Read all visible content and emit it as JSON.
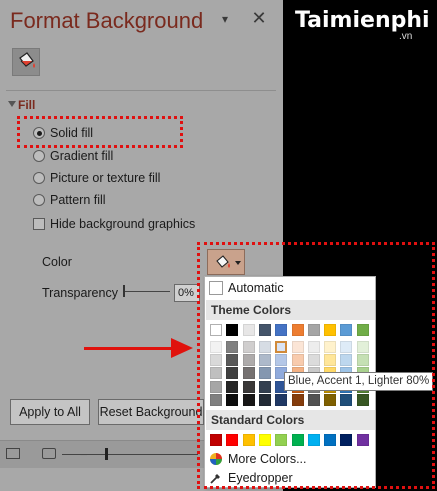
{
  "pane": {
    "title": "Format Background",
    "section": "Fill",
    "options": [
      {
        "label": "Solid fill",
        "selected": true
      },
      {
        "label": "Gradient fill",
        "selected": false
      },
      {
        "label": "Picture or texture fill",
        "selected": false
      },
      {
        "label": "Pattern fill",
        "selected": false
      }
    ],
    "hide_label": "Hide background graphics",
    "color_label": "Color",
    "transparency_label": "Transparency",
    "transparency_value": "0%",
    "apply_label": "Apply to All",
    "reset_label": "Reset Background"
  },
  "popup": {
    "automatic": "Automatic",
    "theme_header": "Theme Colors",
    "standard_header": "Standard Colors",
    "more_colors": "More Colors...",
    "eyedropper": "Eyedropper",
    "theme_top": [
      "#ffffff",
      "#000000",
      "#e7e6e6",
      "#44546a",
      "#4472c4",
      "#ed7d31",
      "#a5a5a5",
      "#ffc000",
      "#5b9bd5",
      "#70ad47"
    ],
    "theme_shades": [
      [
        "#f2f2f2",
        "#808080",
        "#d0cece",
        "#d6dce4",
        "#dae3f3",
        "#fbe5d6",
        "#ededed",
        "#fff2cc",
        "#deebf7",
        "#e2f0d9"
      ],
      [
        "#d9d9d9",
        "#595959",
        "#aeabab",
        "#adb9ca",
        "#b4c7e7",
        "#f8cbad",
        "#dbdbdb",
        "#ffe699",
        "#bdd7ee",
        "#c5e0b4"
      ],
      [
        "#bfbfbf",
        "#404040",
        "#757171",
        "#8497b0",
        "#8faadc",
        "#f4b183",
        "#c9c9c9",
        "#ffd966",
        "#9dc3e6",
        "#a9d18e"
      ],
      [
        "#a6a6a6",
        "#262626",
        "#3a3838",
        "#333f50",
        "#2f5597",
        "#c55a11",
        "#7b7b7b",
        "#bf9000",
        "#2e75b6",
        "#548235"
      ],
      [
        "#808080",
        "#0d0d0d",
        "#171616",
        "#222a35",
        "#203864",
        "#843c0c",
        "#525252",
        "#7f6000",
        "#1f4e79",
        "#385723"
      ]
    ],
    "standard": [
      "#c00000",
      "#ff0000",
      "#ffc000",
      "#ffff00",
      "#92d050",
      "#00b050",
      "#00b0f0",
      "#0070c0",
      "#002060",
      "#7030a0"
    ]
  },
  "tooltip": "Blue, Accent 1, Lighter 80%",
  "logo": {
    "brand": "Taimienphi",
    "domain": ".vn"
  },
  "colors": {
    "accent": "#7a2a1e",
    "highlight": "#e0120d"
  }
}
